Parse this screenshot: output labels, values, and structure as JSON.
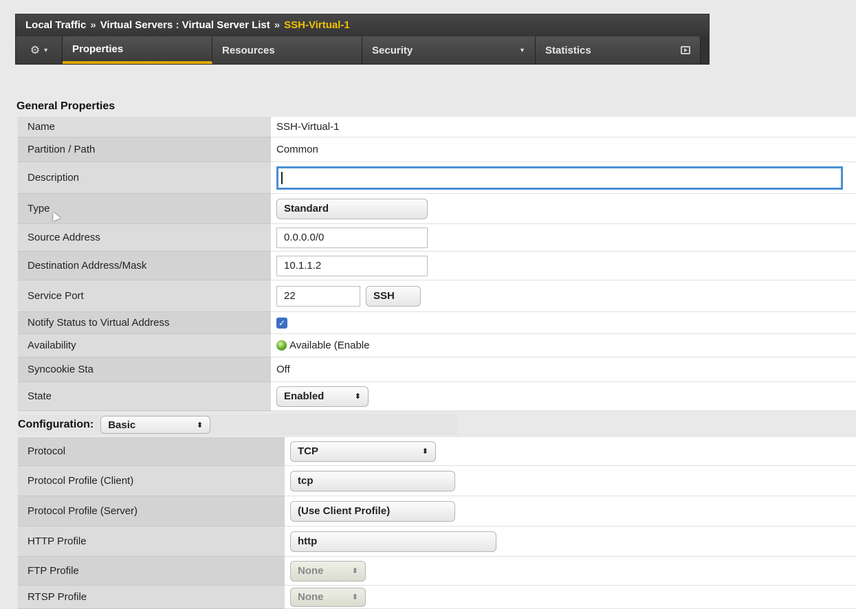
{
  "breadcrumb": {
    "part1": "Local Traffic",
    "sep": "»",
    "part2": "Virtual Servers : Virtual Server List",
    "sep2": "»",
    "current": "SSH-Virtual-1"
  },
  "tabs": {
    "gear": "⚙",
    "gear_caret": "▾",
    "items": [
      {
        "label": "Properties",
        "active": true
      },
      {
        "label": "Resources"
      },
      {
        "label": "Security",
        "has_dropdown": true
      },
      {
        "label": "Statistics",
        "has_icon": true
      }
    ],
    "dropdown_caret": "▾"
  },
  "general": {
    "title": "General Properties",
    "rows": [
      {
        "label": "Name",
        "value": "SSH-Virtual-1"
      },
      {
        "label": "Partition / Path",
        "value": "Common"
      },
      {
        "label": "Description",
        "value": ""
      },
      {
        "label": "Type",
        "value": "Standard"
      },
      {
        "label": "Source Address",
        "value": "0.0.0.0/0"
      },
      {
        "label": "Destination Address/Mask",
        "value": "10.1.1.2"
      },
      {
        "label": "Service Port",
        "value": "22",
        "select": "SSH"
      },
      {
        "label": "Notify Status to Virtual Address",
        "checked": true,
        "check_glyph": "✓"
      },
      {
        "label": "Availability",
        "value": "Available (Enable"
      },
      {
        "label": "Syncookie Sta",
        "value": "Off"
      },
      {
        "label": "State",
        "value": "Enabled"
      }
    ]
  },
  "configuration": {
    "label": "Configuration:",
    "mode": "Basic",
    "arrows": "⬍",
    "rows": [
      {
        "label": "Protocol",
        "value": "TCP"
      },
      {
        "label": "Protocol Profile (Client)",
        "value": "tcp"
      },
      {
        "label": "Protocol Profile (Server)",
        "value": "(Use Client Profile)"
      },
      {
        "label": "HTTP Profile",
        "value": "http"
      },
      {
        "label": "FTP Profile",
        "value": "None"
      },
      {
        "label": "RTSP Profile",
        "value": "None"
      }
    ]
  }
}
